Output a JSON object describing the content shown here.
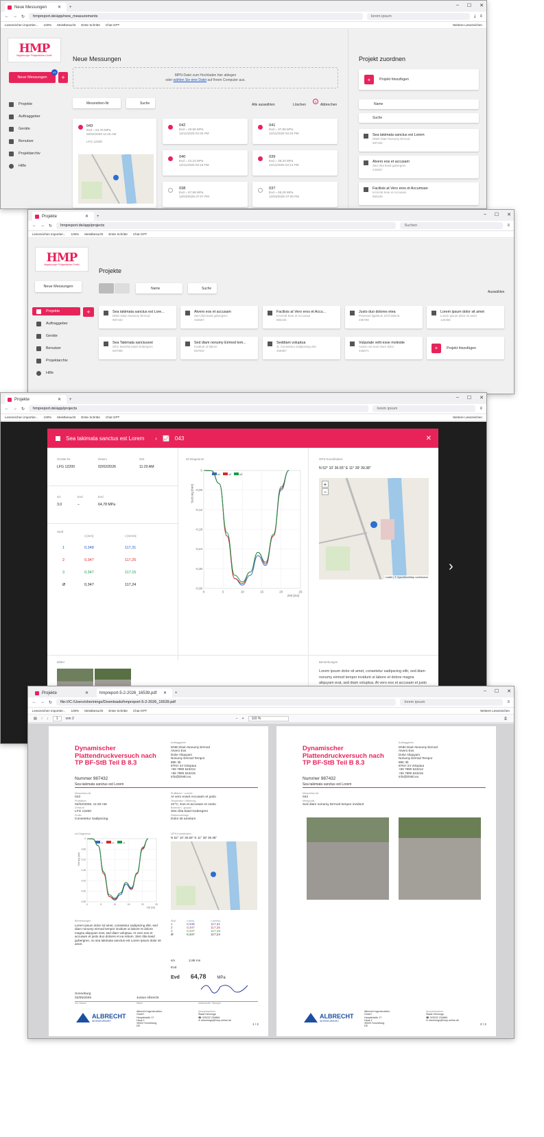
{
  "win1": {
    "tab": "Neue Messungen",
    "url": "hmpreport.de/app/new_measurements",
    "search": "lorem ipsum",
    "bookmarks": [
      "Lesezeichen importier...",
      "Meistbesucht",
      "Erste Schritte",
      "Chat GPT"
    ],
    "bookmarks_right": "Weitere Lesezeichen",
    "zoom": "100%",
    "logo": "HMP",
    "logo_sub": "Magdeburger Prüfgerätebau GmbH",
    "new_btn": "Neue Messungen",
    "badge": "43",
    "nav": [
      "Projekte",
      "Auftraggeber",
      "Geräte",
      "Benutzer",
      "Projektarchiv",
      "Hilfe"
    ],
    "title": "Neue Messungen",
    "drop1": "MPN-Datei zum Hochladen hier ablegen",
    "drop2a": "oder ",
    "drop2link": "wählen Sie eine Datei",
    "drop2b": " auf Ihrem Computer aus.",
    "sort": "Messreihen-Nr",
    "search_btn": "Suche",
    "select_all": "Alle auswählen",
    "delete": "Löschen",
    "cancel": "Abbrechen",
    "delete_badge": "5",
    "measurements": [
      {
        "id": "043",
        "evd": "Evd = 64,78 MPa",
        "date": "02/02/2026 11:20 AM",
        "checked": true
      },
      {
        "id": "042",
        "evd": "Evd = 40,66 MPa",
        "date": "12/11/2025 02:46 PM",
        "checked": true
      },
      {
        "id": "041",
        "evd": "Evd = 37,88 MPa",
        "date": "12/11/2025 02:43 PM",
        "checked": true
      },
      {
        "id": "040",
        "evd": "Evd = 42,24 MPa",
        "date": "12/11/2025 02:18 PM",
        "checked": true
      },
      {
        "id": "039",
        "evd": "Evd = 38,33 MPa",
        "date": "12/11/2025 02:13 PM",
        "checked": true
      },
      {
        "id": "038",
        "evd": "Evd = 67,98 MPa",
        "date": "12/03/2025 07:07 PM",
        "checked": false
      },
      {
        "id": "037",
        "evd": "Evd = 58,29 MPa",
        "date": "12/03/2025 07:06 PM",
        "checked": false
      }
    ],
    "device": "LFG 12200",
    "map_credit": "Leaflet | © OpenStreetMap contributors",
    "assign_title": "Projekt zuordnen",
    "add_project": "Projekt hinzufügen",
    "name_sort": "Name",
    "suche": "Suche",
    "assign_projects": [
      {
        "name": "Sea takimata sanctus est Lorem",
        "client": "DNEi Diam Nonumy Eirmod",
        "nr": "987432"
      },
      {
        "name": "Atvero eos et accusam",
        "client": "Stet clita kasd gubergren",
        "nr": "234567"
      },
      {
        "name": "Facilisis at Vero eros et Accumsan",
        "client": "KASAM Keie et Accusam",
        "nr": "882245"
      }
    ]
  },
  "win2": {
    "tab": "Projekte",
    "url": "hmpreport.de/app/projects",
    "search": "Suchen",
    "title": "Projekte",
    "sort": "Name",
    "search_btn": "Suche",
    "select": "Auswählen",
    "projects": [
      {
        "name": "Sea takimata sanctus est Lore...",
        "client": "DNEi Diam Nonumy Eirmod",
        "nr": "987432"
      },
      {
        "name": "Atvero eos et accusam",
        "client": "Stet clita kasd gubergren",
        "nr": "234567"
      },
      {
        "name": "Facilisis at Vero eros et Accu...",
        "client": "KASAM Keie et Accusam",
        "nr": "882245"
      },
      {
        "name": "Justo duo dolores etea",
        "client": "Praesent ligaltrum Zzril delenit",
        "nr": "456789"
      },
      {
        "name": "Lorem ipsum dolor sit amet",
        "client": "Lorem ipsum dolor sit amet",
        "nr": "123456"
      },
      {
        "name": "Sea Takimata sanctusest",
        "client": "SKG Stetclita kasd Gubergren",
        "nr": "567098"
      },
      {
        "name": "Sed diam nonumy Eirmod tem...",
        "client": "Invidunt ut labore",
        "nr": "567943"
      },
      {
        "name": "Seddiam voluptua",
        "client": "JL Consetetur Sadipscing elis",
        "nr": "456987"
      },
      {
        "name": "Vulputate velit esse molestie",
        "client": "Autem vel eum iriure dolor",
        "nr": "345671"
      }
    ],
    "add_project": "Projekt hinzufügen"
  },
  "win3": {
    "tab": "Projekte",
    "url": "hmpreport.de/app/projects",
    "search": "lorem ipsum",
    "modal_project": "Sea takimata sanctus est Lorem",
    "modal_id": "043",
    "labels": {
      "device": "Geräte-Nr",
      "date": "Datum",
      "time": "Zeit",
      "sv": "s/v",
      "evd": "Evd",
      "evd2": "Evd",
      "stoss": "Stoß",
      "s": "s [mm]",
      "v": "v [mm/s]",
      "chart": "s/t-Diagramm",
      "gps": "GPS-Koordinaten",
      "images": "Bilder",
      "notes": "Bemerkungen"
    },
    "device": "LFG 12200",
    "date": "02/02/2026",
    "time": "11:20 AM",
    "sv": "3,0",
    "evd_dash": "–",
    "evd": "64,78 MPa",
    "gps": "N 52° 10' 36.55\" E 11° 39' 39.38\"",
    "rows": [
      {
        "n": "1",
        "s": "0,348",
        "v": "117,31"
      },
      {
        "n": "2",
        "s": "0,347",
        "v": "117,25"
      },
      {
        "n": "3",
        "s": "0,347",
        "v": "117,15"
      },
      {
        "n": "Ø",
        "s": "0,347",
        "v": "117,24"
      }
    ],
    "notes": "Lorem ipsum dolor sit amet, consetetur sadipscing elitr, sed diam nonumy eirmod tempor invidunt ut labore et dolore magna aliquyam erat, sed diam voluptua. At vero eos et accusam et justo duo dolores et ea rebum. Stet clita kasd gubergren, no sea takimata sanctus est Lorem ipsum dolor sit amet.",
    "map_credit": "Leaflet | © OpenStreetMap contributors"
  },
  "win4": {
    "tab1": "Projekte",
    "tab2": "hmpreport-5-2-2026_16539.pdf",
    "url": "file:///C:/Users/sherinings/Downloads/hmpreport-5-2-2026_16539.pdf",
    "search": "lorem ipsum",
    "page_of": "von 2",
    "page_num": "1",
    "zoom": "110 %",
    "report_title": "Dynamischer Plattendruckversuch nach TP BF-StB Teil B 8.3",
    "nummer": "Nummer 987432",
    "project": "Sea takimata sanctus est Lorem",
    "client_label": "Auftraggeber",
    "client": [
      "DNEi Diam Nonumy Eirmod",
      "Atvero Eos",
      "Dolor Aliquyam",
      "Nonumy Eirmod Tempor",
      "89K 3b",
      "87KH 24 Voluptua",
      "+56 7890 543212",
      "+56 7890 543215",
      "info@DNEi.eu"
    ],
    "fields": [
      {
        "l": "Messreihen-Nr",
        "v": "043"
      },
      {
        "l": "Prüfdatum",
        "v": "02/02/2026, 11:20 AM"
      },
      {
        "l": "Gerät-Nr",
        "v": "LFG 12200"
      },
      {
        "l": "Prüfer",
        "v": "Consetetur Sadipscing"
      },
      {
        "l": "Prüffläche / -schicht",
        "v": "At vero eoset Accusam et justo"
      },
      {
        "l": "Temperatur / Witterung",
        "v": "24°C, Eos et accusam et Justo"
      },
      {
        "l": "Bodenart / -gruppe",
        "v": "Stet clita kasd Gubergren"
      },
      {
        "l": "Plattenunterlage",
        "v": "Dolor sit ametum"
      }
    ],
    "sv_label": "s/v",
    "sv_val": "2,96 ms",
    "evd2_label": "Evd",
    "evd_label": "Evd",
    "evd_val": "64,78",
    "evd_unit": "MPa",
    "place": "Sonneburg",
    "date_sign": "02/05/2026",
    "signer": "Justus Albrecht",
    "sign_label1": "Ort, Datum",
    "sign_label2": "Name",
    "sign_label3": "Unterschrift / Stempel",
    "footer_company": [
      "Albrecht Ingenieurbüro",
      "GmbH",
      "Hauptstraße 17",
      "Haus 1",
      "39020  Sonneburg",
      "DE"
    ],
    "footer_contact_label": "Ansprechpartner",
    "footer_contact": [
      "Skadi Hennings",
      "☎ 025222 234866",
      "✉ shennings@hmp-online.de"
    ],
    "page1": "1 / 2",
    "page2": "2 / 2",
    "p2_field1_label": "Messreihen-Nr",
    "p2_field1": "043",
    "p2_field2_label": "Messpunkt",
    "p2_field2": "Sed diam nonumy Eirmod tempor invidunt",
    "logo_word": "ALBRECHT",
    "logo_sub": "INGENIEURBÜRO"
  },
  "colors": {
    "accent": "#e8235a",
    "s1": "#3466c8",
    "s2": "#d62a2a",
    "s3": "#1a9a4a"
  },
  "chart_data": {
    "type": "line",
    "title": "s/t-Diagramm",
    "xlabel": "Zeit [ms]",
    "ylabel": "Setzung [mm]",
    "x": [
      0,
      2,
      4,
      6,
      8,
      10,
      12,
      14,
      16,
      18,
      20,
      22
    ],
    "xlim": [
      0,
      25
    ],
    "ylim": [
      -0.36,
      0
    ],
    "series": [
      {
        "name": "s1",
        "values": [
          0,
          -0.001,
          -0.04,
          -0.2,
          -0.33,
          -0.35,
          -0.32,
          -0.26,
          -0.29,
          -0.2,
          -0.06,
          0
        ]
      },
      {
        "name": "s2",
        "values": [
          0,
          -0.001,
          -0.04,
          -0.2,
          -0.33,
          -0.345,
          -0.31,
          -0.25,
          -0.285,
          -0.2,
          -0.055,
          0
        ]
      },
      {
        "name": "s3",
        "values": [
          0,
          -0.001,
          -0.04,
          -0.19,
          -0.32,
          -0.34,
          -0.31,
          -0.25,
          -0.28,
          -0.195,
          -0.05,
          0
        ]
      }
    ]
  }
}
